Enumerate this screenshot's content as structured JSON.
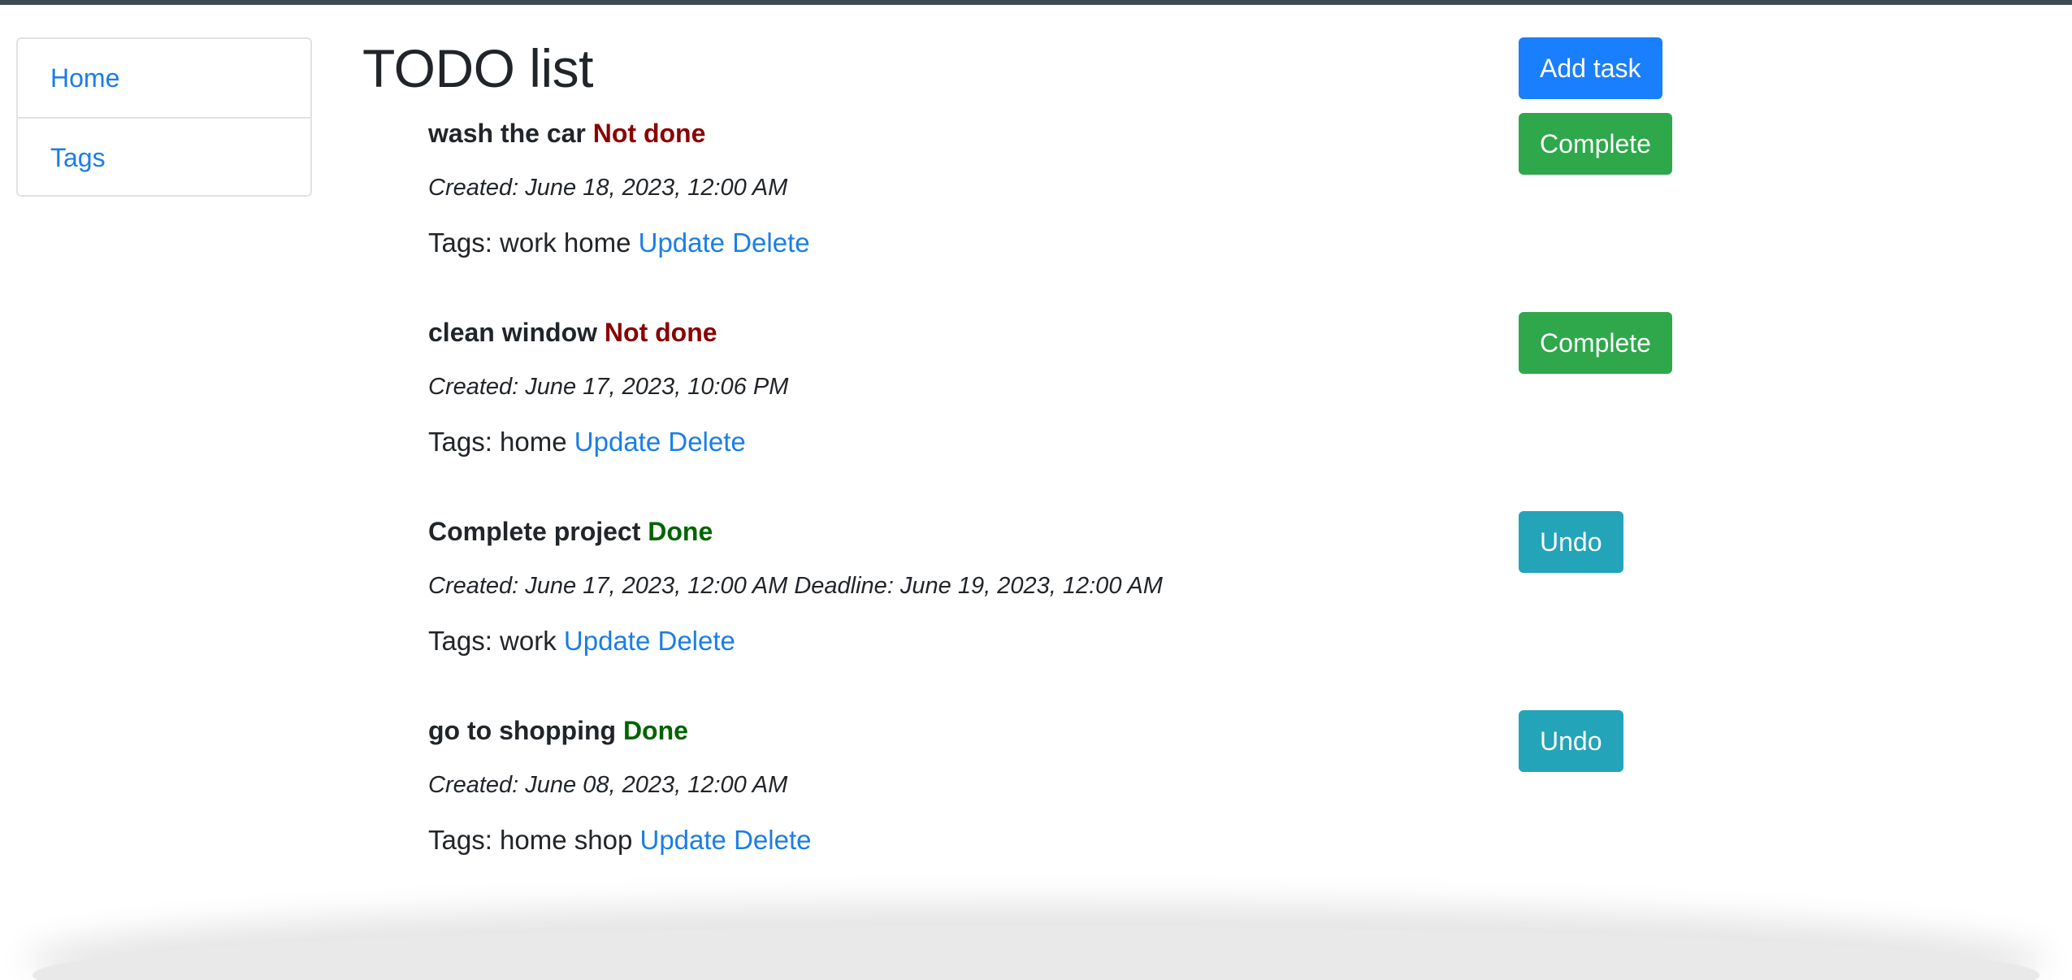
{
  "sidebar": {
    "items": [
      {
        "label": "Home"
      },
      {
        "label": "Tags"
      }
    ]
  },
  "page": {
    "title": "TODO list",
    "add_task_label": "Add task"
  },
  "colors": {
    "primary": "#1a7ffd",
    "success": "#2ea84b",
    "info": "#23a4b9",
    "not_done": "#8b0000",
    "done": "#006400",
    "link": "#1a7ee6"
  },
  "tasks": [
    {
      "title": "wash the car",
      "status": "Not done",
      "created": "Created: June 18, 2023, 12:00 AM",
      "deadline": "",
      "tags_label": "Tags:",
      "tags": "work home",
      "update_label": "Update",
      "delete_label": "Delete",
      "action_label": "Complete"
    },
    {
      "title": "clean window",
      "status": "Not done",
      "created": "Created: June 17, 2023, 10:06 PM",
      "deadline": "",
      "tags_label": "Tags:",
      "tags": "home",
      "update_label": "Update",
      "delete_label": "Delete",
      "action_label": "Complete"
    },
    {
      "title": "Complete project",
      "status": "Done",
      "created": "Created: June 17, 2023, 12:00 AM",
      "deadline": "Deadline: June 19, 2023, 12:00 AM",
      "tags_label": "Tags:",
      "tags": "work",
      "update_label": "Update",
      "delete_label": "Delete",
      "action_label": "Undo"
    },
    {
      "title": "go to shopping",
      "status": "Done",
      "created": "Created: June 08, 2023, 12:00 AM",
      "deadline": "",
      "tags_label": "Tags:",
      "tags": "home shop",
      "update_label": "Update",
      "delete_label": "Delete",
      "action_label": "Undo"
    }
  ]
}
